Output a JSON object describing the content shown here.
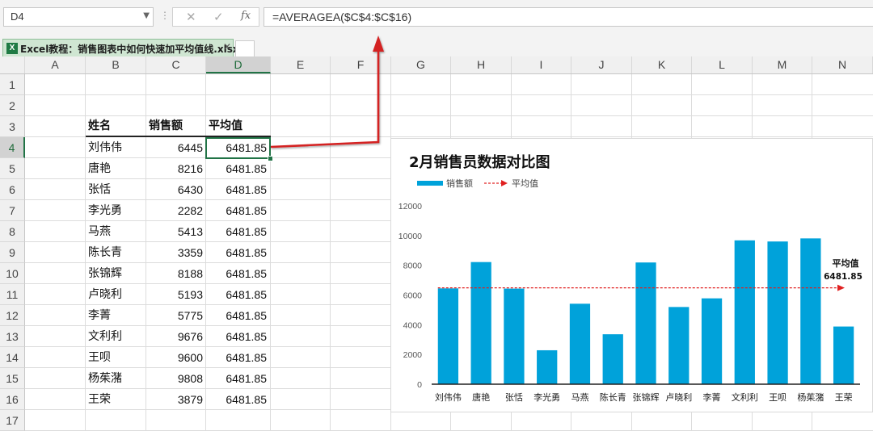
{
  "formula_bar": {
    "name_box": "D4",
    "dots": "⋮",
    "cancel_icon": "✕",
    "enter_icon": "✓",
    "fx_icon": "fx",
    "formula": "=AVERAGEA($C$4:$C$16)"
  },
  "sheet_tab": {
    "file_name": "Excel教程：销售图表中如何快速加平均值线.xlsx",
    "close": "✕"
  },
  "columns": [
    "A",
    "B",
    "C",
    "D",
    "E",
    "F",
    "G",
    "H",
    "I",
    "J",
    "K",
    "L",
    "M",
    "N"
  ],
  "selected_cell": "D4",
  "rows": [
    "1",
    "2",
    "3",
    "4",
    "5",
    "6",
    "7",
    "8",
    "9",
    "10",
    "11",
    "12",
    "13",
    "14",
    "15",
    "16",
    "17"
  ],
  "table": {
    "headers": [
      "姓名",
      "销售额",
      "平均值"
    ],
    "records": [
      {
        "name": "刘伟伟",
        "sales": "6445",
        "avg": "6481.85"
      },
      {
        "name": "唐艳",
        "sales": "8216",
        "avg": "6481.85"
      },
      {
        "name": "张恬",
        "sales": "6430",
        "avg": "6481.85"
      },
      {
        "name": "李光勇",
        "sales": "2282",
        "avg": "6481.85"
      },
      {
        "name": "马燕",
        "sales": "5413",
        "avg": "6481.85"
      },
      {
        "name": "陈长青",
        "sales": "3359",
        "avg": "6481.85"
      },
      {
        "name": "张锦辉",
        "sales": "8188",
        "avg": "6481.85"
      },
      {
        "name": "卢晓利",
        "sales": "5193",
        "avg": "6481.85"
      },
      {
        "name": "李菁",
        "sales": "5775",
        "avg": "6481.85"
      },
      {
        "name": "文利利",
        "sales": "9676",
        "avg": "6481.85"
      },
      {
        "name": "王呗",
        "sales": "9600",
        "avg": "6481.85"
      },
      {
        "name": "杨茱潴",
        "sales": "9808",
        "avg": "6481.85"
      },
      {
        "name": "王荣",
        "sales": "3879",
        "avg": "6481.85"
      }
    ]
  },
  "chart_data": {
    "type": "bar",
    "title": "2月销售员数据对比图",
    "categories": [
      "刘伟伟",
      "唐艳",
      "张恬",
      "李光勇",
      "马燕",
      "陈长青",
      "张锦辉",
      "卢晓利",
      "李菁",
      "文利利",
      "王呗",
      "杨茱潴",
      "王荣"
    ],
    "series": [
      {
        "name": "销售额",
        "values": [
          6445,
          8216,
          6430,
          2282,
          5413,
          3359,
          8188,
          5193,
          5775,
          9676,
          9600,
          9808,
          3879
        ],
        "color": "#00a2da"
      },
      {
        "name": "平均值",
        "values": [
          6481.85,
          6481.85,
          6481.85,
          6481.85,
          6481.85,
          6481.85,
          6481.85,
          6481.85,
          6481.85,
          6481.85,
          6481.85,
          6481.85,
          6481.85
        ],
        "color": "#e02020",
        "style": "dashed-arrow"
      }
    ],
    "ylim": [
      0,
      12000
    ],
    "yticks": [
      0,
      2000,
      4000,
      6000,
      8000,
      10000,
      12000
    ],
    "legend_position": "top-left",
    "avg_label": "平均值",
    "avg_value_label": "6481.85",
    "grid": false
  },
  "colors": {
    "accent": "#217346",
    "bar": "#00a2da",
    "avg_line": "#e02020",
    "callout_arrow": "#d42020"
  }
}
